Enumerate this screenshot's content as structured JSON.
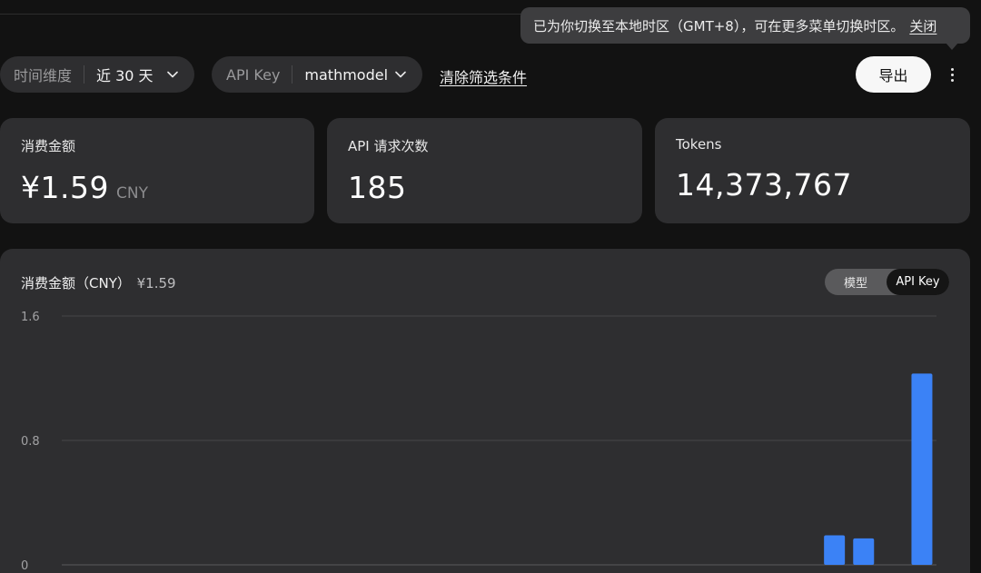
{
  "tooltip": {
    "message": "已为你切换至本地时区（GMT+8），可在更多菜单切换时区。",
    "close_label": "关闭"
  },
  "filters": {
    "time": {
      "label": "时间维度",
      "value": "近 30 天"
    },
    "api_key": {
      "label": "API Key",
      "value": "mathmodel"
    },
    "clear_label": "清除筛选条件"
  },
  "actions": {
    "export_label": "导出",
    "more_icon": "more-vertical-icon"
  },
  "stats": [
    {
      "label": "消费金额",
      "value": "¥1.59",
      "unit": "CNY"
    },
    {
      "label": "API 请求次数",
      "value": "185",
      "unit": ""
    },
    {
      "label": "Tokens",
      "value": "14,373,767",
      "unit": ""
    }
  ],
  "chart": {
    "title": "消费金额（CNY）",
    "total": "¥1.59",
    "toggle": {
      "options": [
        "模型",
        "API Key"
      ],
      "selected": "API Key"
    }
  },
  "chart_data": {
    "type": "bar",
    "title": "消费金额（CNY）",
    "ylim": [
      0,
      1.6
    ],
    "y_ticks": [
      {
        "label": "1.6",
        "value": 1.6
      },
      {
        "label": "0.8",
        "value": 0.8
      },
      {
        "label": "0",
        "value": 0
      }
    ],
    "grid": true,
    "bar_color": "#3b82f6",
    "categories_count": 30,
    "values": [
      0,
      0,
      0,
      0,
      0,
      0,
      0,
      0,
      0,
      0,
      0,
      0,
      0,
      0,
      0,
      0,
      0,
      0,
      0,
      0,
      0,
      0,
      0,
      0,
      0,
      0,
      0.19,
      0.17,
      0,
      1.23
    ]
  }
}
